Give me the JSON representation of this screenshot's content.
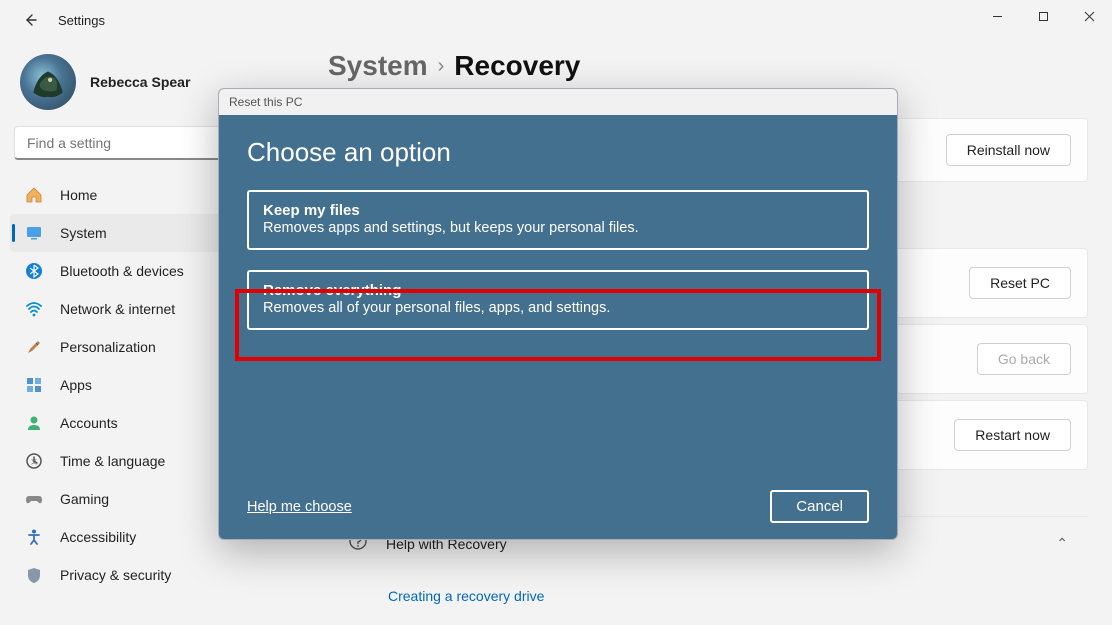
{
  "window": {
    "app_title": "Settings"
  },
  "profile": {
    "name": "Rebecca Spear"
  },
  "search": {
    "placeholder": "Find a setting"
  },
  "sidebar": {
    "items": [
      {
        "icon": "home-icon",
        "label": "Home"
      },
      {
        "icon": "system-icon",
        "label": "System"
      },
      {
        "icon": "bluetooth-icon",
        "label": "Bluetooth & devices"
      },
      {
        "icon": "network-icon",
        "label": "Network & internet"
      },
      {
        "icon": "personalization-icon",
        "label": "Personalization"
      },
      {
        "icon": "apps-icon",
        "label": "Apps"
      },
      {
        "icon": "accounts-icon",
        "label": "Accounts"
      },
      {
        "icon": "time-icon",
        "label": "Time & language"
      },
      {
        "icon": "gaming-icon",
        "label": "Gaming"
      },
      {
        "icon": "accessibility-icon",
        "label": "Accessibility"
      },
      {
        "icon": "privacy-icon",
        "label": "Privacy & security"
      }
    ],
    "active_index": 1
  },
  "breadcrumb": {
    "parent": "System",
    "current": "Recovery"
  },
  "actions": {
    "reinstall": "Reinstall now",
    "reset": "Reset PC",
    "goback": "Go back",
    "restart": "Restart now",
    "help_header": "Help with Recovery",
    "help_link": "Creating a recovery drive"
  },
  "modal": {
    "title_bar": "Reset this PC",
    "heading": "Choose an option",
    "options": [
      {
        "title": "Keep my files",
        "desc": "Removes apps and settings, but keeps your personal files."
      },
      {
        "title": "Remove everything",
        "desc": "Removes all of your personal files, apps, and settings."
      }
    ],
    "help": "Help me choose",
    "cancel": "Cancel",
    "highlighted_index": 1
  }
}
